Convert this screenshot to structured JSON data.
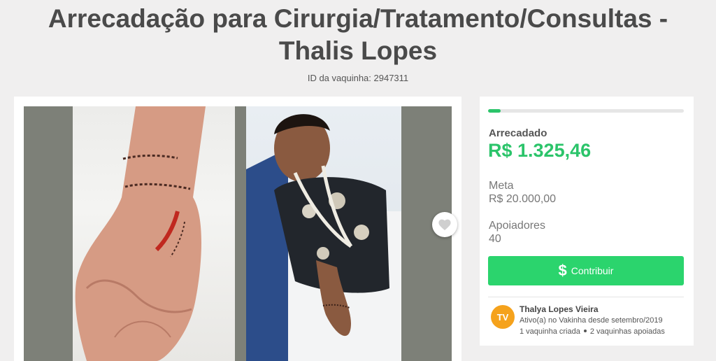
{
  "campaign": {
    "title_line1": "Arrecadação para Cirurgia/Tratamento/Consultas -",
    "title_line2": "Thalis Lopes",
    "id_label": "ID da vaquinha: 2947311"
  },
  "stats": {
    "progress_fraction": 0.066,
    "raised_label": "Arrecadado",
    "raised_amount": "R$ 1.325,46",
    "goal_label": "Meta",
    "goal_amount": "R$ 20.000,00",
    "supporters_label": "Apoiadores",
    "supporters_count": "40"
  },
  "actions": {
    "contribute_icon": "$",
    "contribute_label": "Contribuir",
    "favorite_icon": "heart-icon"
  },
  "owner": {
    "initials": "TV",
    "name": "Thalya Lopes Vieira",
    "active_since": "Ativo(a) no Vakinha desde setembro/2019",
    "created_count": "1 vaquinha criada",
    "supported_count": "2 vaquinhas apoiadas"
  },
  "colors": {
    "accent_green": "#2bc46a",
    "button_green": "#2bd46d",
    "avatar_orange": "#f5a21c"
  }
}
